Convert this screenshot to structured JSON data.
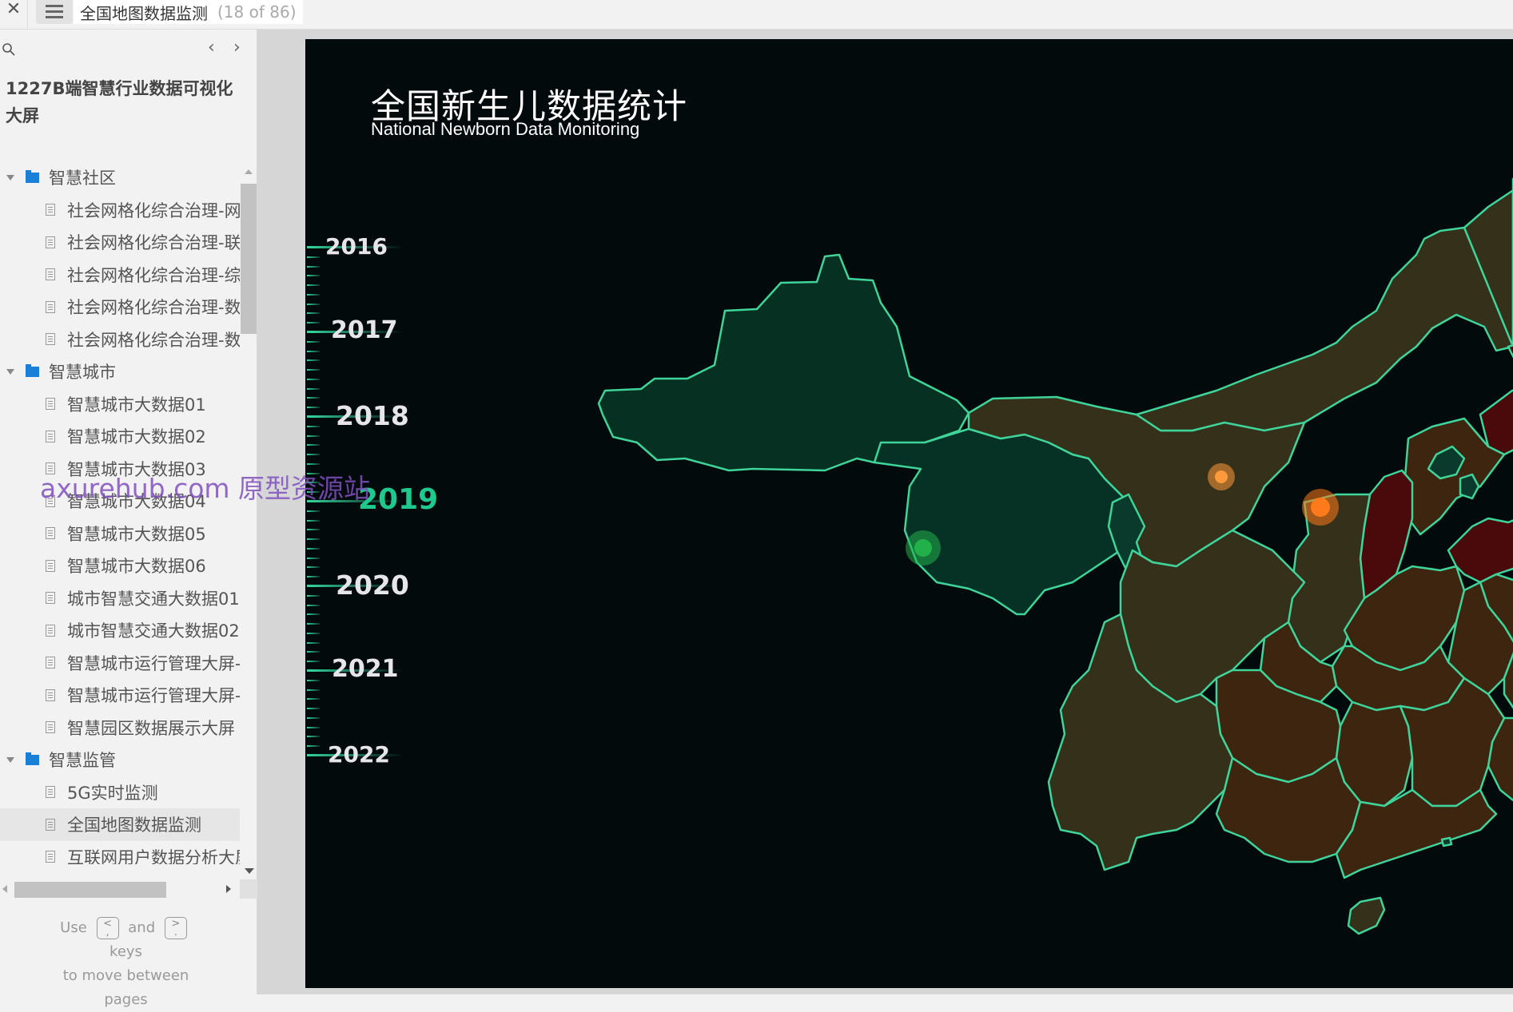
{
  "topbar": {
    "close_icon": "close-icon",
    "menu_icon": "hamburger-menu-icon",
    "page_title": "全国地图数据监测",
    "page_count": "(18 of 86)"
  },
  "sidebar": {
    "search_icon": "search-icon",
    "prev_label": "‹",
    "next_label": "›",
    "project_title": "1227B端智慧行业数据可视化大屏",
    "tree": [
      {
        "type": "folder",
        "label": "智慧社区"
      },
      {
        "type": "page",
        "label": "社会网格化综合治理-网"
      },
      {
        "type": "page",
        "label": "社会网格化综合治理-联"
      },
      {
        "type": "page",
        "label": "社会网格化综合治理-综"
      },
      {
        "type": "page",
        "label": "社会网格化综合治理-数"
      },
      {
        "type": "page",
        "label": "社会网格化综合治理-数"
      },
      {
        "type": "folder",
        "label": "智慧城市"
      },
      {
        "type": "page",
        "label": "智慧城市大数据01"
      },
      {
        "type": "page",
        "label": "智慧城市大数据02"
      },
      {
        "type": "page",
        "label": "智慧城市大数据03"
      },
      {
        "type": "page",
        "label": "智慧城市大数据04"
      },
      {
        "type": "page",
        "label": "智慧城市大数据05"
      },
      {
        "type": "page",
        "label": "智慧城市大数据06"
      },
      {
        "type": "page",
        "label": "城市智慧交通大数据01"
      },
      {
        "type": "page",
        "label": "城市智慧交通大数据02"
      },
      {
        "type": "page",
        "label": "智慧城市运行管理大屏-"
      },
      {
        "type": "page",
        "label": "智慧城市运行管理大屏-"
      },
      {
        "type": "page",
        "label": "智慧园区数据展示大屏"
      },
      {
        "type": "folder",
        "label": "智慧监管"
      },
      {
        "type": "page",
        "label": "5G实时监测"
      },
      {
        "type": "page",
        "label": "全国地图数据监测",
        "selected": true
      },
      {
        "type": "page",
        "label": "互联网用户数据分析大屏"
      }
    ],
    "hint": {
      "use": "Use",
      "key_prev": "<\n,",
      "and": "and",
      "key_next": ">\n.",
      "keys": "keys",
      "line2": "to move between",
      "line3": "pages"
    }
  },
  "canvas": {
    "title": "全国新生儿数据统计",
    "subtitle": "National Newborn Data Monitoring",
    "timeline": {
      "years": [
        "2016",
        "2017",
        "2018",
        "2019",
        "2020",
        "2021",
        "2022"
      ],
      "active_year": "2019"
    },
    "map": {
      "legend_colors": {
        "low": "#063022",
        "mid": "#35301a",
        "high": "#3e2510",
        "max": "#4a0a0c",
        "border": "#3fd49a"
      },
      "markers": [
        {
          "name": "qinghai-marker",
          "level": "low",
          "color": "#22b04a"
        },
        {
          "name": "shanxi-marker",
          "level": "high",
          "color": "#ff9a3c"
        },
        {
          "name": "shandong-marker",
          "level": "max",
          "color": "#ff7a1a"
        }
      ]
    }
  },
  "watermark": "axurehub.com 原型资源站"
}
